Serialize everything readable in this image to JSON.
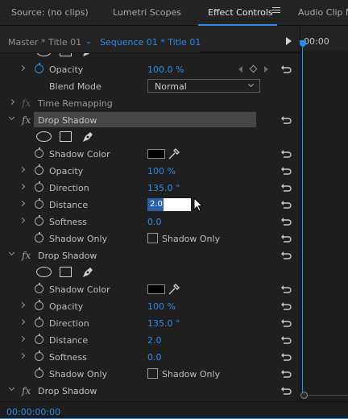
{
  "tabs": [
    {
      "label": "Source: (no clips)"
    },
    {
      "label": "Lumetri Scopes"
    },
    {
      "label": "Effect Controls",
      "active": true
    },
    {
      "label": "Audio Clip Mi"
    }
  ],
  "subbar": {
    "master_label": "Master * Title 01",
    "chevron": "⌄",
    "sequence_label": "Sequence 01 * Title 01"
  },
  "timeline": {
    "ruler_time": "00:00"
  },
  "status": {
    "timecode": "00:00:00:00"
  },
  "opacity_section": {
    "opacity_label": "Opacity",
    "opacity_value": "100.0 %",
    "blend_mode_label": "Blend Mode",
    "blend_mode_value": "Normal"
  },
  "time_remapping_label": "Time Remapping",
  "drop_shadow_1": {
    "name": "Drop Shadow",
    "shadow_color_label": "Shadow Color",
    "opacity_label": "Opacity",
    "opacity_value": "100 %",
    "direction_label": "Direction",
    "direction_value": "135.0 °",
    "distance_label": "Distance",
    "distance_value": "2.0",
    "softness_label": "Softness",
    "softness_value": "0.0",
    "shadow_only_label": "Shadow Only",
    "shadow_only_checkbox_label": "Shadow Only"
  },
  "drop_shadow_2": {
    "name": "Drop Shadow",
    "shadow_color_label": "Shadow Color",
    "opacity_label": "Opacity",
    "opacity_value": "100 %",
    "direction_label": "Direction",
    "direction_value": "135.0 °",
    "distance_label": "Distance",
    "distance_value": "2.0",
    "softness_label": "Softness",
    "softness_value": "0.0",
    "shadow_only_label": "Shadow Only",
    "shadow_only_checkbox_label": "Shadow Only"
  },
  "drop_shadow_3": {
    "name": "Drop Shadow"
  },
  "colors": {
    "accent": "#2d8ceb",
    "panel": "#1f1f1f",
    "highlight": "#464646"
  }
}
